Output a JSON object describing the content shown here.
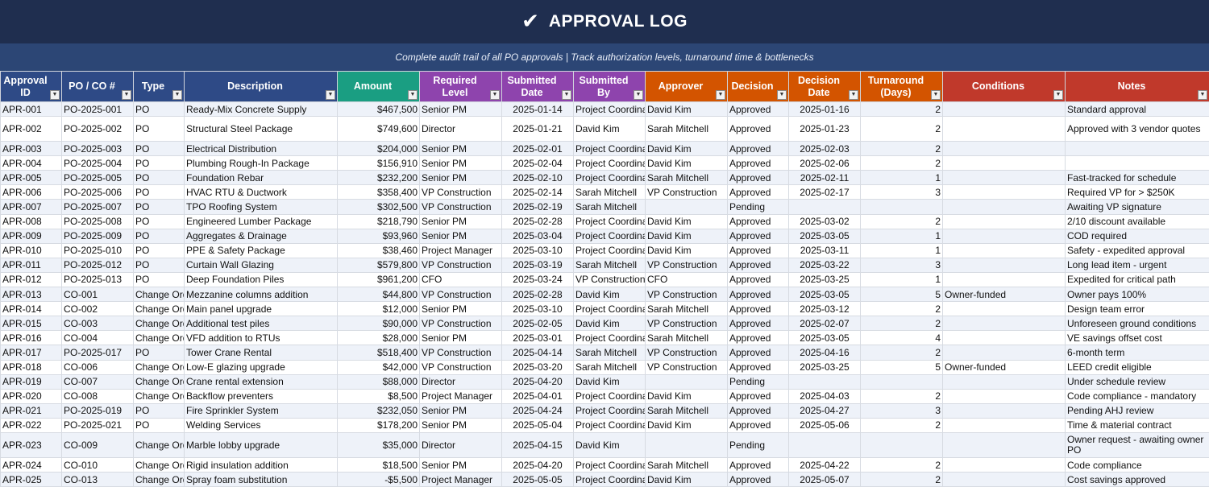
{
  "header": {
    "title": "APPROVAL LOG",
    "subtitle": "Complete audit trail of all PO approvals  |  Track authorization levels, turnaround time & bottlenecks"
  },
  "colors": {
    "title_bg": "#1f2e4f",
    "subtitle_bg": "#2c4675",
    "blue": "#2e4a86",
    "green": "#1a9e82",
    "purple": "#8e44ad",
    "orange": "#d35400",
    "red": "#c0392b"
  },
  "columns": [
    {
      "label": "Approval ID",
      "color": "blue"
    },
    {
      "label": "PO / CO #",
      "color": "blue"
    },
    {
      "label": "Type",
      "color": "blue"
    },
    {
      "label": "Description",
      "color": "blue"
    },
    {
      "label": "Amount",
      "color": "green"
    },
    {
      "label": "Required Level",
      "color": "purple"
    },
    {
      "label": "Submitted Date",
      "color": "purple"
    },
    {
      "label": "Submitted By",
      "color": "purple"
    },
    {
      "label": "Approver",
      "color": "orange"
    },
    {
      "label": "Decision",
      "color": "orange"
    },
    {
      "label": "Decision Date",
      "color": "orange"
    },
    {
      "label": "Turnaround (Days)",
      "color": "orange"
    },
    {
      "label": "Conditions",
      "color": "red"
    },
    {
      "label": "Notes",
      "color": "red"
    }
  ],
  "filter_icon": "dropdown-arrow-icon",
  "rows": [
    [
      "APR-001",
      "PO-2025-001",
      "PO",
      "Ready-Mix Concrete Supply",
      "$467,500",
      "Senior PM",
      "2025-01-14",
      "Project Coordinator",
      "David Kim",
      "Approved",
      "2025-01-16",
      "2",
      "",
      "Standard approval"
    ],
    [
      "APR-002",
      "PO-2025-002",
      "PO",
      "Structural Steel Package",
      "$749,600",
      "Director",
      "2025-01-21",
      "David Kim",
      "Sarah Mitchell",
      "Approved",
      "2025-01-23",
      "2",
      "",
      "Approved with 3 vendor quotes"
    ],
    [
      "APR-003",
      "PO-2025-003",
      "PO",
      "Electrical Distribution",
      "$204,000",
      "Senior PM",
      "2025-02-01",
      "Project Coordinator",
      "David Kim",
      "Approved",
      "2025-02-03",
      "2",
      "",
      ""
    ],
    [
      "APR-004",
      "PO-2025-004",
      "PO",
      "Plumbing Rough-In Package",
      "$156,910",
      "Senior PM",
      "2025-02-04",
      "Project Coordinator",
      "David Kim",
      "Approved",
      "2025-02-06",
      "2",
      "",
      ""
    ],
    [
      "APR-005",
      "PO-2025-005",
      "PO",
      "Foundation Rebar",
      "$232,200",
      "Senior PM",
      "2025-02-10",
      "Project Coordinator",
      "Sarah Mitchell",
      "Approved",
      "2025-02-11",
      "1",
      "",
      "Fast-tracked for schedule"
    ],
    [
      "APR-006",
      "PO-2025-006",
      "PO",
      "HVAC RTU & Ductwork",
      "$358,400",
      "VP Construction",
      "2025-02-14",
      "Sarah Mitchell",
      "VP Construction",
      "Approved",
      "2025-02-17",
      "3",
      "",
      "Required VP for > $250K"
    ],
    [
      "APR-007",
      "PO-2025-007",
      "PO",
      "TPO Roofing System",
      "$302,500",
      "VP Construction",
      "2025-02-19",
      "Sarah Mitchell",
      "",
      "Pending",
      "",
      "",
      "",
      "Awaiting VP signature"
    ],
    [
      "APR-008",
      "PO-2025-008",
      "PO",
      "Engineered Lumber Package",
      "$218,790",
      "Senior PM",
      "2025-02-28",
      "Project Coordinator",
      "David Kim",
      "Approved",
      "2025-03-02",
      "2",
      "",
      "2/10 discount available"
    ],
    [
      "APR-009",
      "PO-2025-009",
      "PO",
      "Aggregates & Drainage",
      "$93,960",
      "Senior PM",
      "2025-03-04",
      "Project Coordinator",
      "David Kim",
      "Approved",
      "2025-03-05",
      "1",
      "",
      "COD required"
    ],
    [
      "APR-010",
      "PO-2025-010",
      "PO",
      "PPE & Safety Package",
      "$38,460",
      "Project Manager",
      "2025-03-10",
      "Project Coordinator",
      "David Kim",
      "Approved",
      "2025-03-11",
      "1",
      "",
      "Safety - expedited approval"
    ],
    [
      "APR-011",
      "PO-2025-012",
      "PO",
      "Curtain Wall Glazing",
      "$579,800",
      "VP Construction",
      "2025-03-19",
      "Sarah Mitchell",
      "VP Construction",
      "Approved",
      "2025-03-22",
      "3",
      "",
      "Long lead item - urgent"
    ],
    [
      "APR-012",
      "PO-2025-013",
      "PO",
      "Deep Foundation Piles",
      "$961,200",
      "CFO",
      "2025-03-24",
      "VP Construction",
      "CFO",
      "Approved",
      "2025-03-25",
      "1",
      "",
      "Expedited for critical path"
    ],
    [
      "APR-013",
      "CO-001",
      "Change Order",
      "Mezzanine columns addition",
      "$44,800",
      "VP Construction",
      "2025-02-28",
      "David Kim",
      "VP Construction",
      "Approved",
      "2025-03-05",
      "5",
      "Owner-funded",
      "Owner pays 100%"
    ],
    [
      "APR-014",
      "CO-002",
      "Change Order",
      "Main panel upgrade",
      "$12,000",
      "Senior PM",
      "2025-03-10",
      "Project Coordinator",
      "Sarah Mitchell",
      "Approved",
      "2025-03-12",
      "2",
      "",
      "Design team error"
    ],
    [
      "APR-015",
      "CO-003",
      "Change Order",
      "Additional test piles",
      "$90,000",
      "VP Construction",
      "2025-02-05",
      "David Kim",
      "VP Construction",
      "Approved",
      "2025-02-07",
      "2",
      "",
      "Unforeseen ground conditions"
    ],
    [
      "APR-016",
      "CO-004",
      "Change Order",
      "VFD addition to RTUs",
      "$28,000",
      "Senior PM",
      "2025-03-01",
      "Project Coordinator",
      "Sarah Mitchell",
      "Approved",
      "2025-03-05",
      "4",
      "",
      "VE savings offset cost"
    ],
    [
      "APR-017",
      "PO-2025-017",
      "PO",
      "Tower Crane Rental",
      "$518,400",
      "VP Construction",
      "2025-04-14",
      "Sarah Mitchell",
      "VP Construction",
      "Approved",
      "2025-04-16",
      "2",
      "",
      "6-month term"
    ],
    [
      "APR-018",
      "CO-006",
      "Change Order",
      "Low-E glazing upgrade",
      "$42,000",
      "VP Construction",
      "2025-03-20",
      "Sarah Mitchell",
      "VP Construction",
      "Approved",
      "2025-03-25",
      "5",
      "Owner-funded",
      "LEED credit eligible"
    ],
    [
      "APR-019",
      "CO-007",
      "Change Order",
      "Crane rental extension",
      "$88,000",
      "Director",
      "2025-04-20",
      "David Kim",
      "",
      "Pending",
      "",
      "",
      "",
      "Under schedule review"
    ],
    [
      "APR-020",
      "CO-008",
      "Change Order",
      "Backflow preventers",
      "$8,500",
      "Project Manager",
      "2025-04-01",
      "Project Coordinator",
      "David Kim",
      "Approved",
      "2025-04-03",
      "2",
      "",
      "Code compliance - mandatory"
    ],
    [
      "APR-021",
      "PO-2025-019",
      "PO",
      "Fire Sprinkler System",
      "$232,050",
      "Senior PM",
      "2025-04-24",
      "Project Coordinator",
      "Sarah Mitchell",
      "Approved",
      "2025-04-27",
      "3",
      "",
      "Pending AHJ review"
    ],
    [
      "APR-022",
      "PO-2025-021",
      "PO",
      "Welding Services",
      "$178,200",
      "Senior PM",
      "2025-05-04",
      "Project Coordinator",
      "David Kim",
      "Approved",
      "2025-05-06",
      "2",
      "",
      "Time & material contract"
    ],
    [
      "APR-023",
      "CO-009",
      "Change Order",
      "Marble lobby upgrade",
      "$35,000",
      "Director",
      "2025-04-15",
      "David Kim",
      "",
      "Pending",
      "",
      "",
      "",
      "Owner request - awaiting owner PO"
    ],
    [
      "APR-024",
      "CO-010",
      "Change Order",
      "Rigid insulation addition",
      "$18,500",
      "Senior PM",
      "2025-04-20",
      "Project Coordinator",
      "Sarah Mitchell",
      "Approved",
      "2025-04-22",
      "2",
      "",
      "Code compliance"
    ],
    [
      "APR-025",
      "CO-013",
      "Change Order",
      "Spray foam substitution",
      "-$5,500",
      "Project Manager",
      "2025-05-05",
      "Project Coordinator",
      "David Kim",
      "Approved",
      "2025-05-07",
      "2",
      "",
      "Cost savings approved"
    ]
  ]
}
